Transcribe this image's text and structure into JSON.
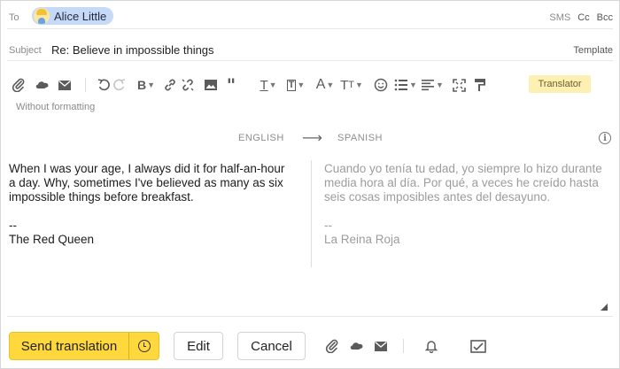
{
  "header": {
    "to_label": "To",
    "recipient": {
      "name": "Alice Little",
      "avatar_icon": "alice-avatar-icon"
    },
    "links": {
      "sms": "SMS",
      "cc": "Cc",
      "bcc": "Bcc"
    },
    "subject_label": "Subject",
    "subject": "Re: Believe in impossible things",
    "template": "Template"
  },
  "toolbar": {
    "icons": [
      "paperclip-icon",
      "cloud-attach-icon",
      "mail-attach-icon",
      "undo-icon",
      "redo-icon",
      "bold-icon",
      "link-icon",
      "unlink-icon",
      "image-icon",
      "quote-icon",
      "text-style-icon",
      "text-box-icon",
      "font-color-icon",
      "font-size-icon",
      "emoji-icon",
      "list-icon",
      "align-icon",
      "fullscreen-icon",
      "format-painter-icon"
    ],
    "translator": "Translator",
    "without_formatting": "Without formatting"
  },
  "translation": {
    "source_lang": "ENGLISH",
    "arrow": "⟶",
    "target_lang": "SPANISH",
    "source_text": "When I was your age, I always did it for half-an-hour\na day. Why, sometimes I've believed as many as six\nimpossible things before breakfast.\n\n--\nThe Red Queen",
    "target_text": "Cuando yo tenía tu edad, yo siempre lo hizo durante\nmedia hora al día. Por qué, a veces he creído hasta\nseis cosas imposibles antes del desayuno.\n\n--\nLa Reina Roja"
  },
  "footer": {
    "send": "Send translation",
    "edit": "Edit",
    "cancel": "Cancel"
  },
  "colors": {
    "accent": "#ffd83d",
    "chip": "#c6d9f7",
    "translator": "#fdf0b2"
  }
}
